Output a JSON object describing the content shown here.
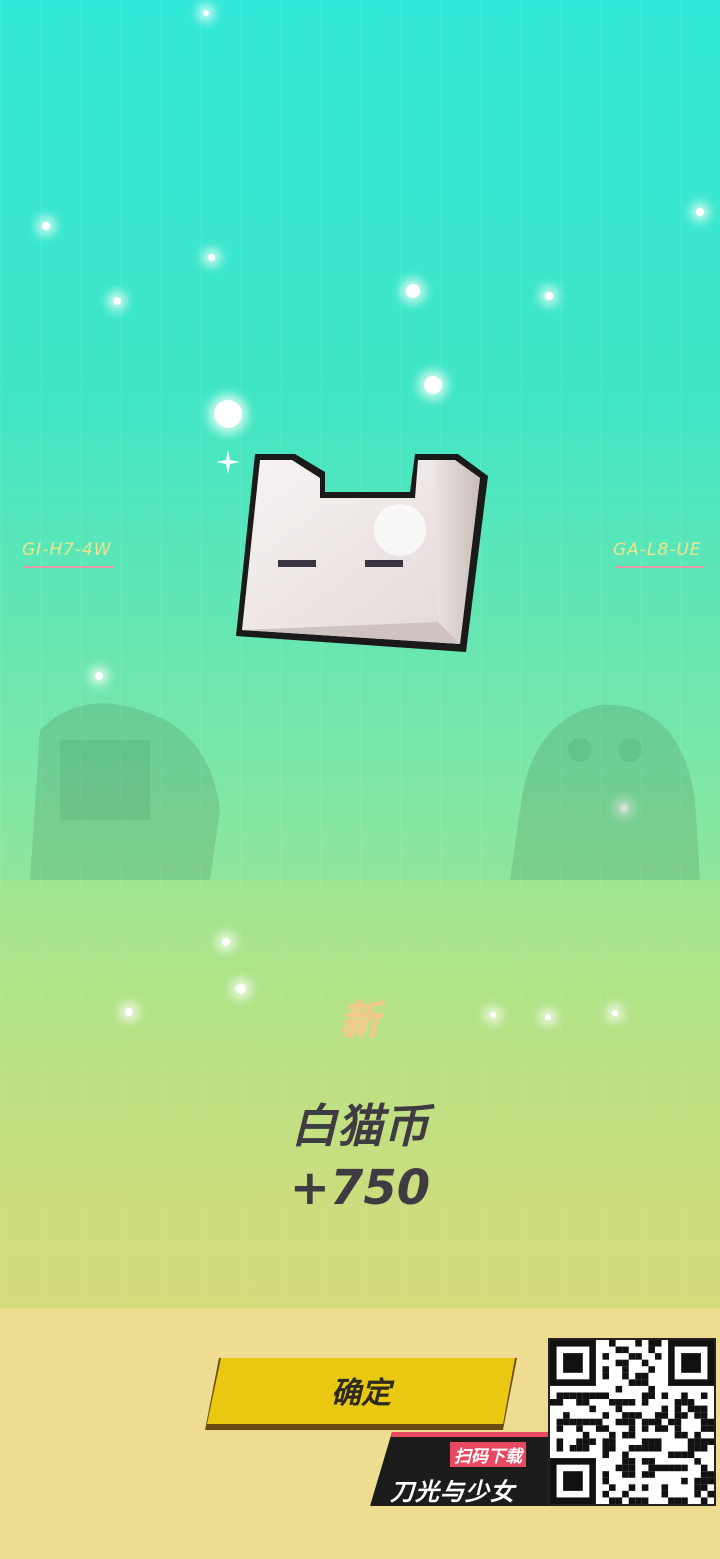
{
  "reward": {
    "new_tag": "新",
    "item_name": "白猫币",
    "amount": "+750"
  },
  "side_codes": {
    "left": "GI-H7-4W",
    "right": "GA-L8-UE"
  },
  "confirm_button": {
    "label": "确定"
  },
  "promo": {
    "scan_label": "扫码下载",
    "game_title": "刀光与少女"
  },
  "icons": {
    "item": "white-cat-coin-icon",
    "qr": "qr-code-icon"
  },
  "colors": {
    "confirm_button": "#e9c812",
    "text_dark": "#3f3b43",
    "new_tag": "#f1c98d",
    "bottom_bar": "#eedd90"
  }
}
